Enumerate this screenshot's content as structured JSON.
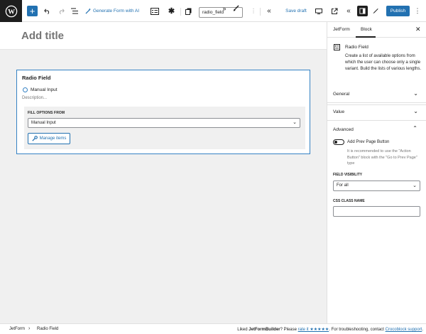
{
  "toolbar": {
    "wp_logo_icon": "wordpress-icon",
    "generate_label": "Generate Form with AI",
    "slug_value": "radio_field",
    "save_draft_label": "Save draft",
    "publish_label": "Publish",
    "accent_color": "#2271b1"
  },
  "editor": {
    "title_placeholder": "Add title",
    "block": {
      "label": "Radio Field",
      "option_label": "Manual Input",
      "description": "Description...",
      "fill_options_label": "FILL OPTIONS FROM",
      "fill_options_value": "Manual Input",
      "manage_items_label": "Manage items"
    }
  },
  "sidebar": {
    "tabs": [
      "JetForm",
      "Block"
    ],
    "active_tab": "Block",
    "block_title": "Radio Field",
    "block_description": "Create a list of available options from which the user can choose only a single variant. Build the lists of various lengths.",
    "panels": [
      "General",
      "Value",
      "Advanced"
    ],
    "advanced": {
      "toggle_label": "Add Prev Page Button",
      "toggle_on": false,
      "help_text": "It is recommended to use the \"Action Button\" block with the \"Go to Prev Page\" type",
      "field_visibility_label": "FIELD VISIBILITY",
      "field_visibility_value": "For all",
      "css_class_label": "CSS CLASS NAME",
      "css_class_value": ""
    }
  },
  "footer": {
    "breadcrumb_root": "JetForm",
    "breadcrumb_item": "Radio Field",
    "note_prefix": "Liked ",
    "note_brand": "JetFormBuilder",
    "note_mid": "? Please ",
    "note_rate": "rate it ★★★★★",
    "note_after_rate": ". For troubleshooting, contact ",
    "note_support": "Crocoblock support",
    "note_end": "."
  }
}
